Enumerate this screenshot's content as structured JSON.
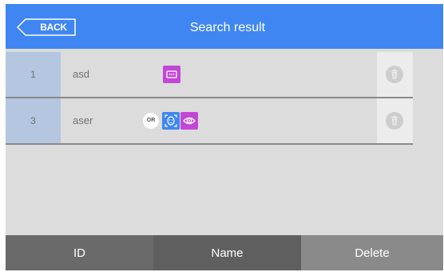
{
  "header": {
    "back_label": "BACK",
    "title": "Search result"
  },
  "rows": [
    {
      "id": "1",
      "name": "asd",
      "methods": [
        "password-icon"
      ]
    },
    {
      "id": "3",
      "name": "aser",
      "or_label": "OR",
      "methods": [
        "face-icon",
        "iris-icon"
      ]
    }
  ],
  "footer": {
    "columns": [
      "ID",
      "Name",
      "Delete"
    ]
  },
  "colors": {
    "header": "#3f86f2",
    "id_cell": "#b4c6e0",
    "password_badge": "#c347d6",
    "face_badge": "#3f86f2",
    "iris_badge": "#c347d6",
    "footer_id": "#6a6a6a",
    "footer_name": "#5f5f5f",
    "footer_delete": "#8a8a8a"
  }
}
